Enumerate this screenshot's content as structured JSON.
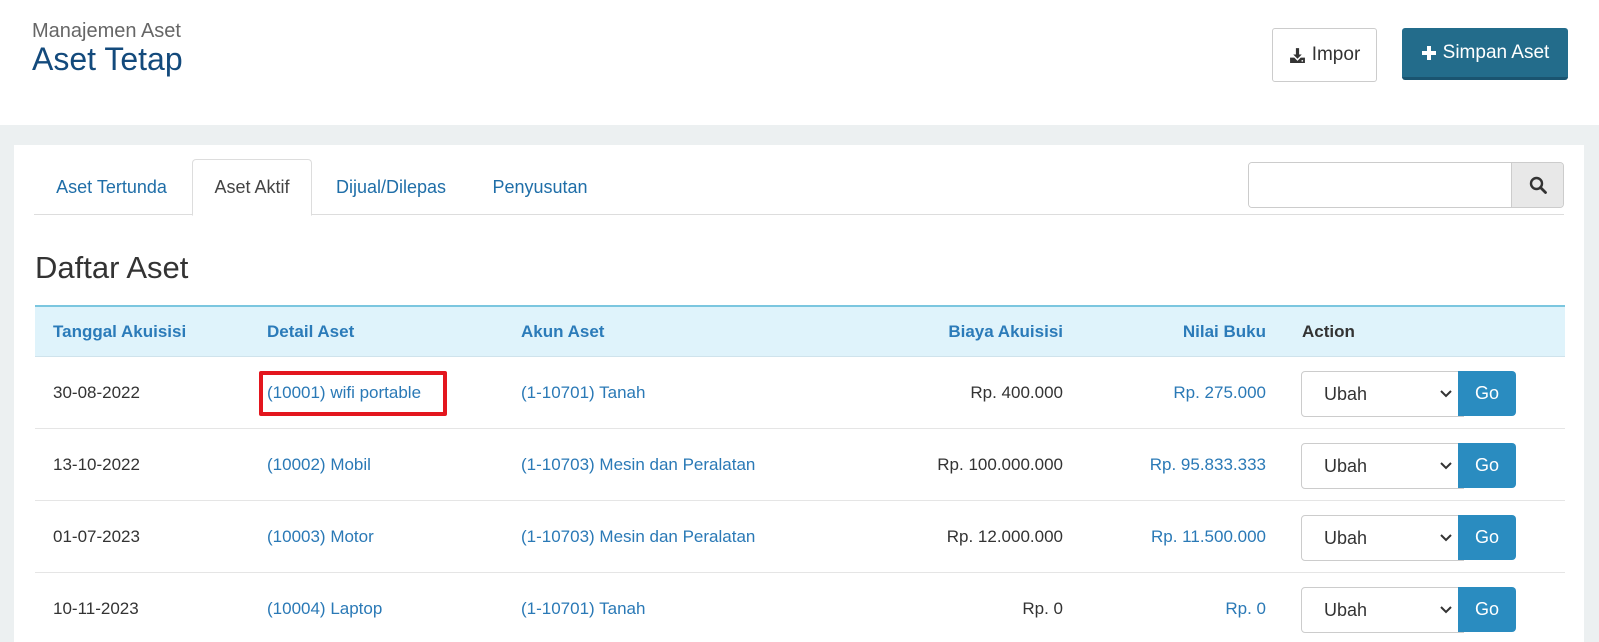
{
  "header": {
    "breadcrumb": "Manajemen Aset",
    "title": "Aset Tetap",
    "import_label": "Impor",
    "save_label": "Simpan Aset"
  },
  "tabs": [
    {
      "label": "Aset Tertunda"
    },
    {
      "label": "Aset Aktif",
      "active": true
    },
    {
      "label": "Dijual/Dilepas"
    },
    {
      "label": "Penyusutan"
    }
  ],
  "search": {
    "placeholder": "",
    "value": ""
  },
  "list": {
    "title": "Daftar Aset",
    "columns": [
      "Tanggal Akuisisi",
      "Detail Aset",
      "Akun Aset",
      "Biaya Akuisisi",
      "Nilai Buku",
      "Action"
    ],
    "rows": [
      {
        "date": "30-08-2022",
        "detail": "(10001) wifi portable",
        "account": "(1-10701) Tanah",
        "cost": "Rp. 400.000",
        "book_value": "Rp. 275.000",
        "action": "Ubah",
        "go": "Go"
      },
      {
        "date": "13-10-2022",
        "detail": "(10002) Mobil",
        "account": "(1-10703) Mesin dan Peralatan",
        "cost": "Rp. 100.000.000",
        "book_value": "Rp. 95.833.333",
        "action": "Ubah",
        "go": "Go"
      },
      {
        "date": "01-07-2023",
        "detail": "(10003) Motor",
        "account": "(1-10703) Mesin dan Peralatan",
        "cost": "Rp. 12.000.000",
        "book_value": "Rp. 11.500.000",
        "action": "Ubah",
        "go": "Go"
      },
      {
        "date": "10-11-2023",
        "detail": "(10004) Laptop",
        "account": "(1-10701) Tanah",
        "cost": "Rp. 0",
        "book_value": "Rp. 0",
        "action": "Ubah",
        "go": "Go"
      }
    ]
  },
  "icons": {
    "import": "download-icon",
    "save": "plus-icon",
    "search": "search-icon",
    "select": "chevron-down-icon"
  },
  "colors": {
    "primary": "#236c8b",
    "link": "#2a79b6",
    "title": "#134a7c",
    "header_bg": "#dff3fb",
    "highlight": "#e3161e",
    "go_button": "#2a8cc0"
  }
}
